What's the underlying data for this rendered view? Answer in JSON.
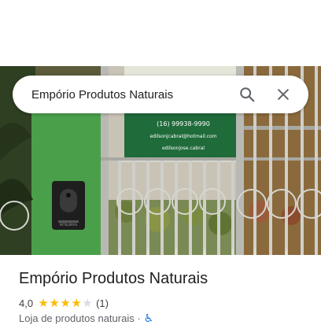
{
  "search": {
    "query": "Empório Produtos Naturais",
    "search_icon": "search-icon",
    "close_icon": "close-icon"
  },
  "photo": {
    "sign_phone": "(16) 99938-9990",
    "sign_email": "edilsonjcabral@hotmail.com",
    "sign_instagram": "edilsonjose.cabral",
    "intercom_brand": "INTELBRAS"
  },
  "place": {
    "name": "Empório Produtos Naturais",
    "rating": "4,0",
    "rating_value": 4,
    "rating_max": 5,
    "review_count": "(1)",
    "category": "Loja de produtos naturais ·",
    "accessibility_icon": "wheelchair-icon"
  },
  "colors": {
    "star": "#fbbc04",
    "star_empty": "#dadce0",
    "accent": "#1a73e8",
    "sign_green": "#1f6b3a"
  }
}
